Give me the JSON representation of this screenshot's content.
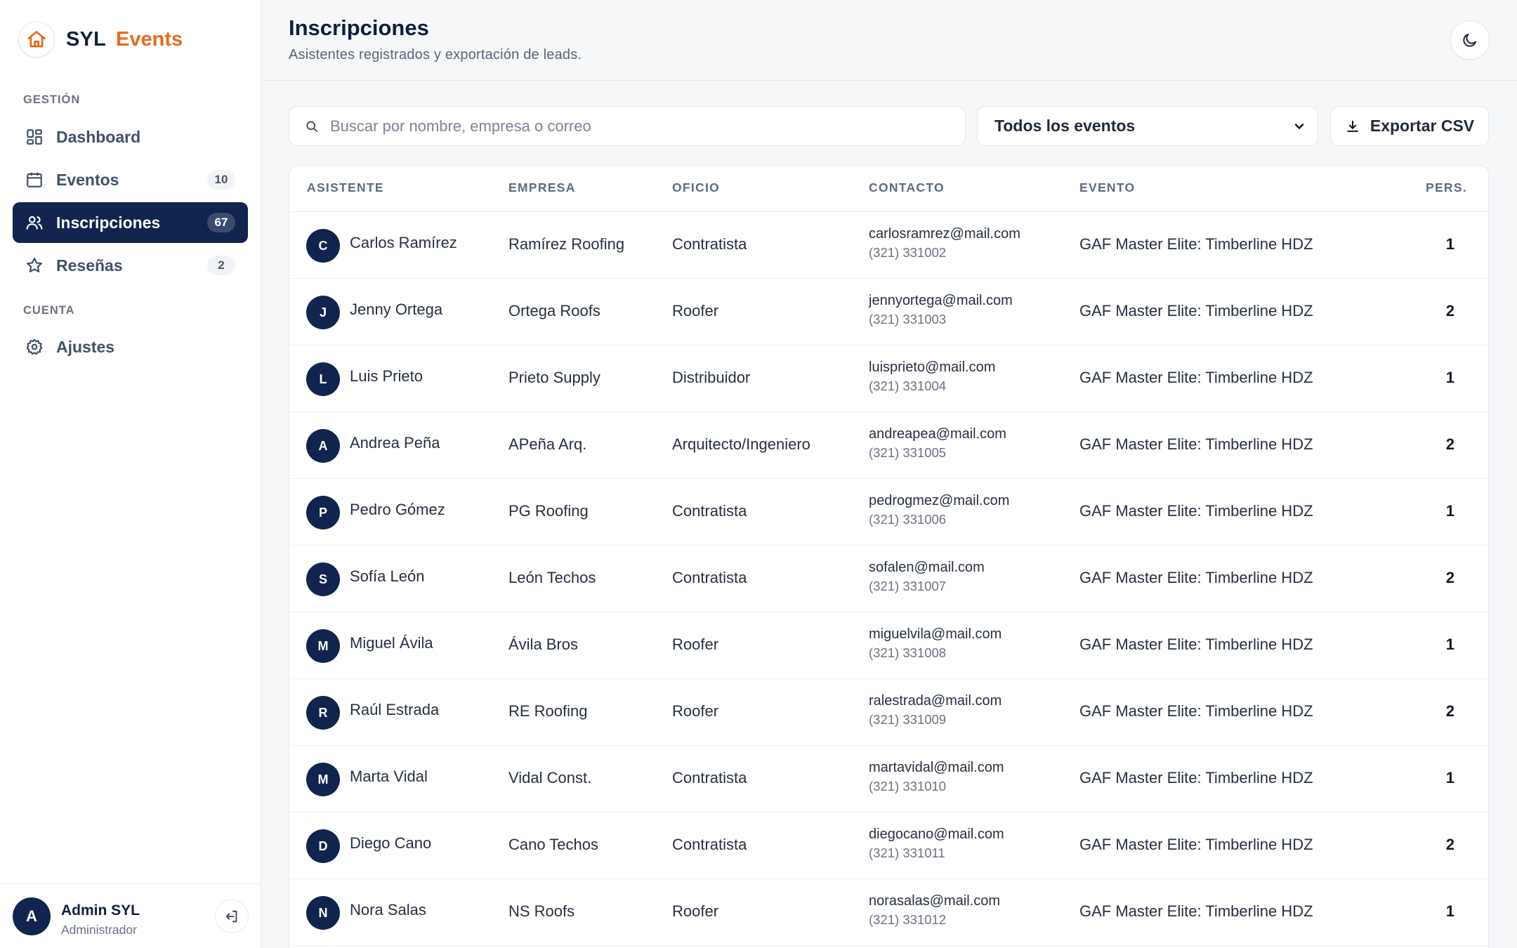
{
  "brand": {
    "name": "SYL",
    "accent": "Events"
  },
  "sidebar": {
    "sections": [
      {
        "label": "GESTIÓN"
      },
      {
        "label": "CUENTA"
      }
    ],
    "items": [
      {
        "label": "Dashboard",
        "icon": "dashboard-icon",
        "badge": ""
      },
      {
        "label": "Eventos",
        "icon": "calendar-icon",
        "badge": "10"
      },
      {
        "label": "Inscripciones",
        "icon": "users-icon",
        "badge": "67",
        "active": true
      },
      {
        "label": "Reseñas",
        "icon": "star-icon",
        "badge": "2"
      },
      {
        "label": "Ajustes",
        "icon": "gear-icon",
        "badge": ""
      }
    ],
    "user": {
      "initial": "A",
      "name": "Admin SYL",
      "role": "Administrador"
    }
  },
  "header": {
    "title": "Inscripciones",
    "subtitle": "Asistentes registrados y exportación de leads."
  },
  "toolbar": {
    "search_placeholder": "Buscar por nombre, empresa o correo",
    "search_value": "",
    "event_filter": "Todos los eventos",
    "export_label": "Exportar CSV"
  },
  "table": {
    "columns": [
      "ASISTENTE",
      "EMPRESA",
      "OFICIO",
      "CONTACTO",
      "EVENTO",
      "PERS."
    ],
    "rows": [
      {
        "initial": "C",
        "name": "Carlos Ramírez",
        "company": "Ramírez Roofing",
        "trade": "Contratista",
        "email": "carlosramrez@mail.com",
        "phone": "(321) 331002",
        "event": "GAF Master Elite: Timberline HDZ",
        "pers": "1"
      },
      {
        "initial": "J",
        "name": "Jenny Ortega",
        "company": "Ortega Roofs",
        "trade": "Roofer",
        "email": "jennyortega@mail.com",
        "phone": "(321) 331003",
        "event": "GAF Master Elite: Timberline HDZ",
        "pers": "2"
      },
      {
        "initial": "L",
        "name": "Luis Prieto",
        "company": "Prieto Supply",
        "trade": "Distribuidor",
        "email": "luisprieto@mail.com",
        "phone": "(321) 331004",
        "event": "GAF Master Elite: Timberline HDZ",
        "pers": "1"
      },
      {
        "initial": "A",
        "name": "Andrea Peña",
        "company": "APeña Arq.",
        "trade": "Arquitecto/Ingeniero",
        "email": "andreapea@mail.com",
        "phone": "(321) 331005",
        "event": "GAF Master Elite: Timberline HDZ",
        "pers": "2"
      },
      {
        "initial": "P",
        "name": "Pedro Gómez",
        "company": "PG Roofing",
        "trade": "Contratista",
        "email": "pedrogmez@mail.com",
        "phone": "(321) 331006",
        "event": "GAF Master Elite: Timberline HDZ",
        "pers": "1"
      },
      {
        "initial": "S",
        "name": "Sofía León",
        "company": "León Techos",
        "trade": "Contratista",
        "email": "sofalen@mail.com",
        "phone": "(321) 331007",
        "event": "GAF Master Elite: Timberline HDZ",
        "pers": "2"
      },
      {
        "initial": "M",
        "name": "Miguel Ávila",
        "company": "Ávila Bros",
        "trade": "Roofer",
        "email": "miguelvila@mail.com",
        "phone": "(321) 331008",
        "event": "GAF Master Elite: Timberline HDZ",
        "pers": "1"
      },
      {
        "initial": "R",
        "name": "Raúl Estrada",
        "company": "RE Roofing",
        "trade": "Roofer",
        "email": "ralestrada@mail.com",
        "phone": "(321) 331009",
        "event": "GAF Master Elite: Timberline HDZ",
        "pers": "2"
      },
      {
        "initial": "M",
        "name": "Marta Vidal",
        "company": "Vidal Const.",
        "trade": "Contratista",
        "email": "martavidal@mail.com",
        "phone": "(321) 331010",
        "event": "GAF Master Elite: Timberline HDZ",
        "pers": "1"
      },
      {
        "initial": "D",
        "name": "Diego Cano",
        "company": "Cano Techos",
        "trade": "Contratista",
        "email": "diegocano@mail.com",
        "phone": "(321) 331011",
        "event": "GAF Master Elite: Timberline HDZ",
        "pers": "2"
      },
      {
        "initial": "N",
        "name": "Nora Salas",
        "company": "NS Roofs",
        "trade": "Roofer",
        "email": "norasalas@mail.com",
        "phone": "(321) 331012",
        "event": "GAF Master Elite: Timberline HDZ",
        "pers": "1"
      }
    ]
  },
  "colors": {
    "navy": "#10244e",
    "accent": "#e46b1f",
    "background": "#f5f7f9"
  }
}
